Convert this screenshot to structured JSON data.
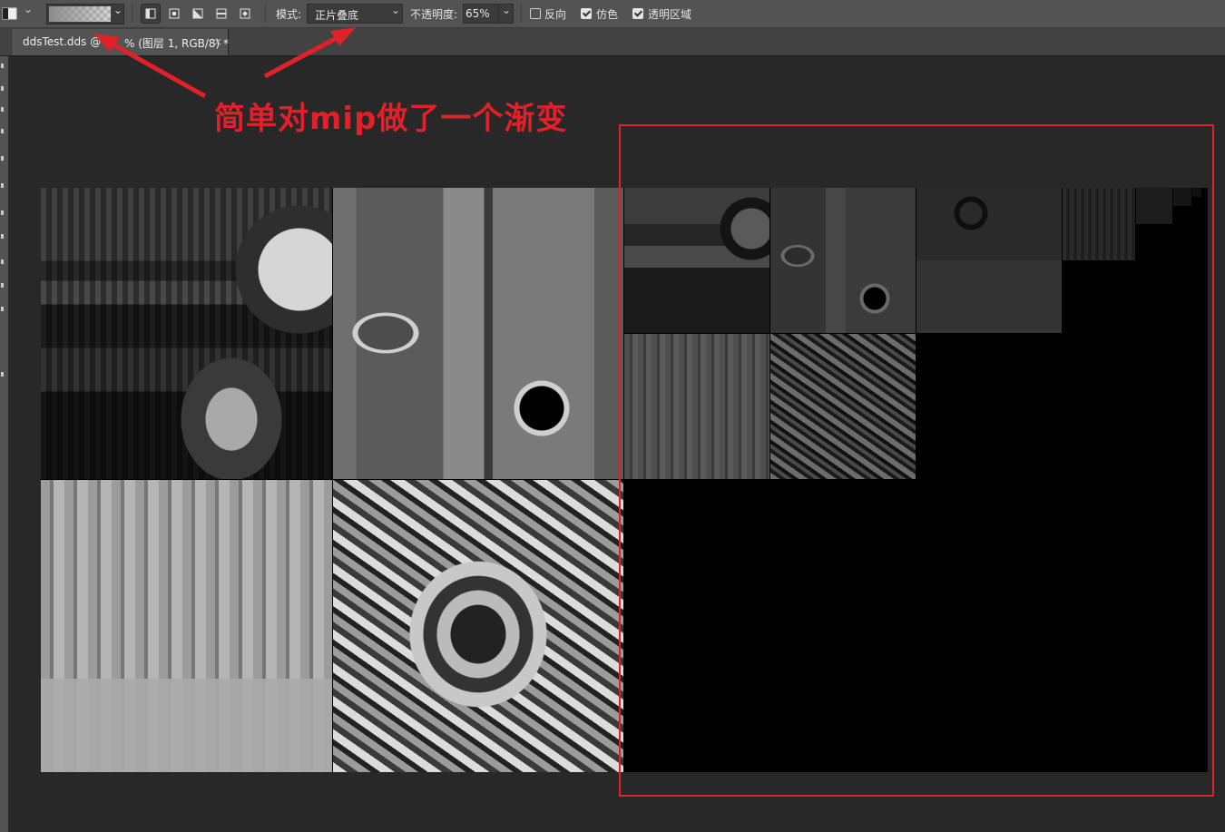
{
  "options_bar": {
    "dropdown_arrow": "⌄",
    "mode_label": "模式:",
    "mode_value": "正片叠底",
    "opacity_label": "不透明度:",
    "opacity_value": "65%",
    "reverse_label": "反向",
    "reverse_checked": false,
    "dither_label": "仿色",
    "dither_checked": true,
    "transparency_label": "透明区域",
    "transparency_checked": true
  },
  "document_tab": {
    "title": "ddsTest.dds @ 6",
    "title_tail": "% (图层 1, RGB/8) *",
    "close": "×"
  },
  "annotation": {
    "text": "简单对mip做了一个渐变",
    "color": "#e1212a"
  },
  "colors": {
    "options_bar_bg": "#535353",
    "workspace_bg": "#282828",
    "annotation_red": "#e1212a"
  }
}
